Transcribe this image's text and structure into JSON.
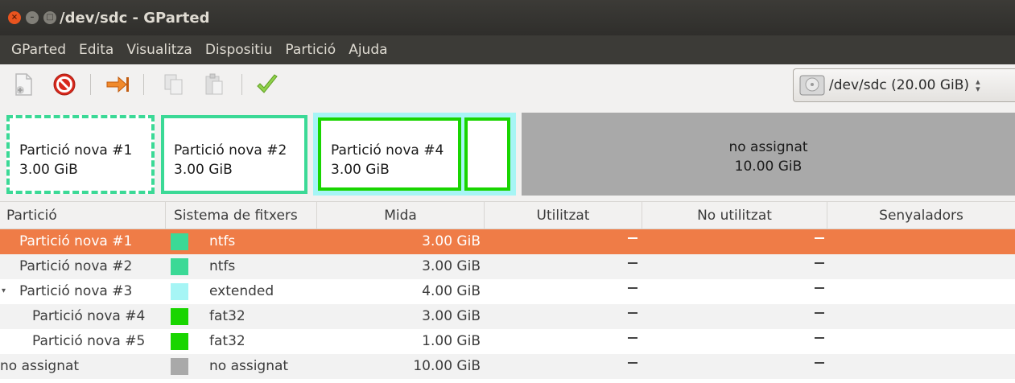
{
  "window": {
    "title": "/dev/sdc - GParted",
    "buttons": {
      "close": "×",
      "minimize": "–",
      "maximize": "□"
    }
  },
  "menu": [
    "GParted",
    "Edita",
    "Visualitza",
    "Dispositiu",
    "Partició",
    "Ajuda"
  ],
  "toolbar": {
    "icons": [
      "new-partition-icon",
      "delete-icon",
      "resize-move-icon",
      "copy-icon",
      "paste-icon",
      "apply-icon"
    ]
  },
  "device": {
    "label": "/dev/sdc  (20.00 GiB)"
  },
  "disk_map": {
    "p1": {
      "name": "Partició nova #1",
      "size": "3.00 GiB"
    },
    "p2": {
      "name": "Partició nova #2",
      "size": "3.00 GiB"
    },
    "p4": {
      "name": "Partició nova #4",
      "size": "3.00 GiB"
    },
    "unallocated": {
      "name": "no assignat",
      "size": "10.00 GiB"
    }
  },
  "colors": {
    "ntfs": "#3bd996",
    "extended": "#a6f5f5",
    "fat32": "#19d500",
    "unallocated": "#a9a9a9",
    "selection": "#ef7c47"
  },
  "table": {
    "headers": [
      "Partició",
      "Sistema de fitxers",
      "Mida",
      "Utilitzat",
      "No utilitzat",
      "Senyaladors"
    ],
    "rows": [
      {
        "partition": "Partició nova #1",
        "fs": "ntfs",
        "size": "3.00 GiB",
        "selected": true
      },
      {
        "partition": "Partició nova #2",
        "fs": "ntfs",
        "size": "3.00 GiB"
      },
      {
        "partition": "Partició nova #3",
        "fs": "extended",
        "size": "4.00 GiB",
        "expander": "▾"
      },
      {
        "partition": "Partició nova #4",
        "fs": "fat32",
        "size": "3.00 GiB"
      },
      {
        "partition": "Partició nova #5",
        "fs": "fat32",
        "size": "1.00 GiB"
      },
      {
        "partition": "no assignat",
        "fs": "no assignat",
        "size": "10.00 GiB"
      }
    ]
  }
}
